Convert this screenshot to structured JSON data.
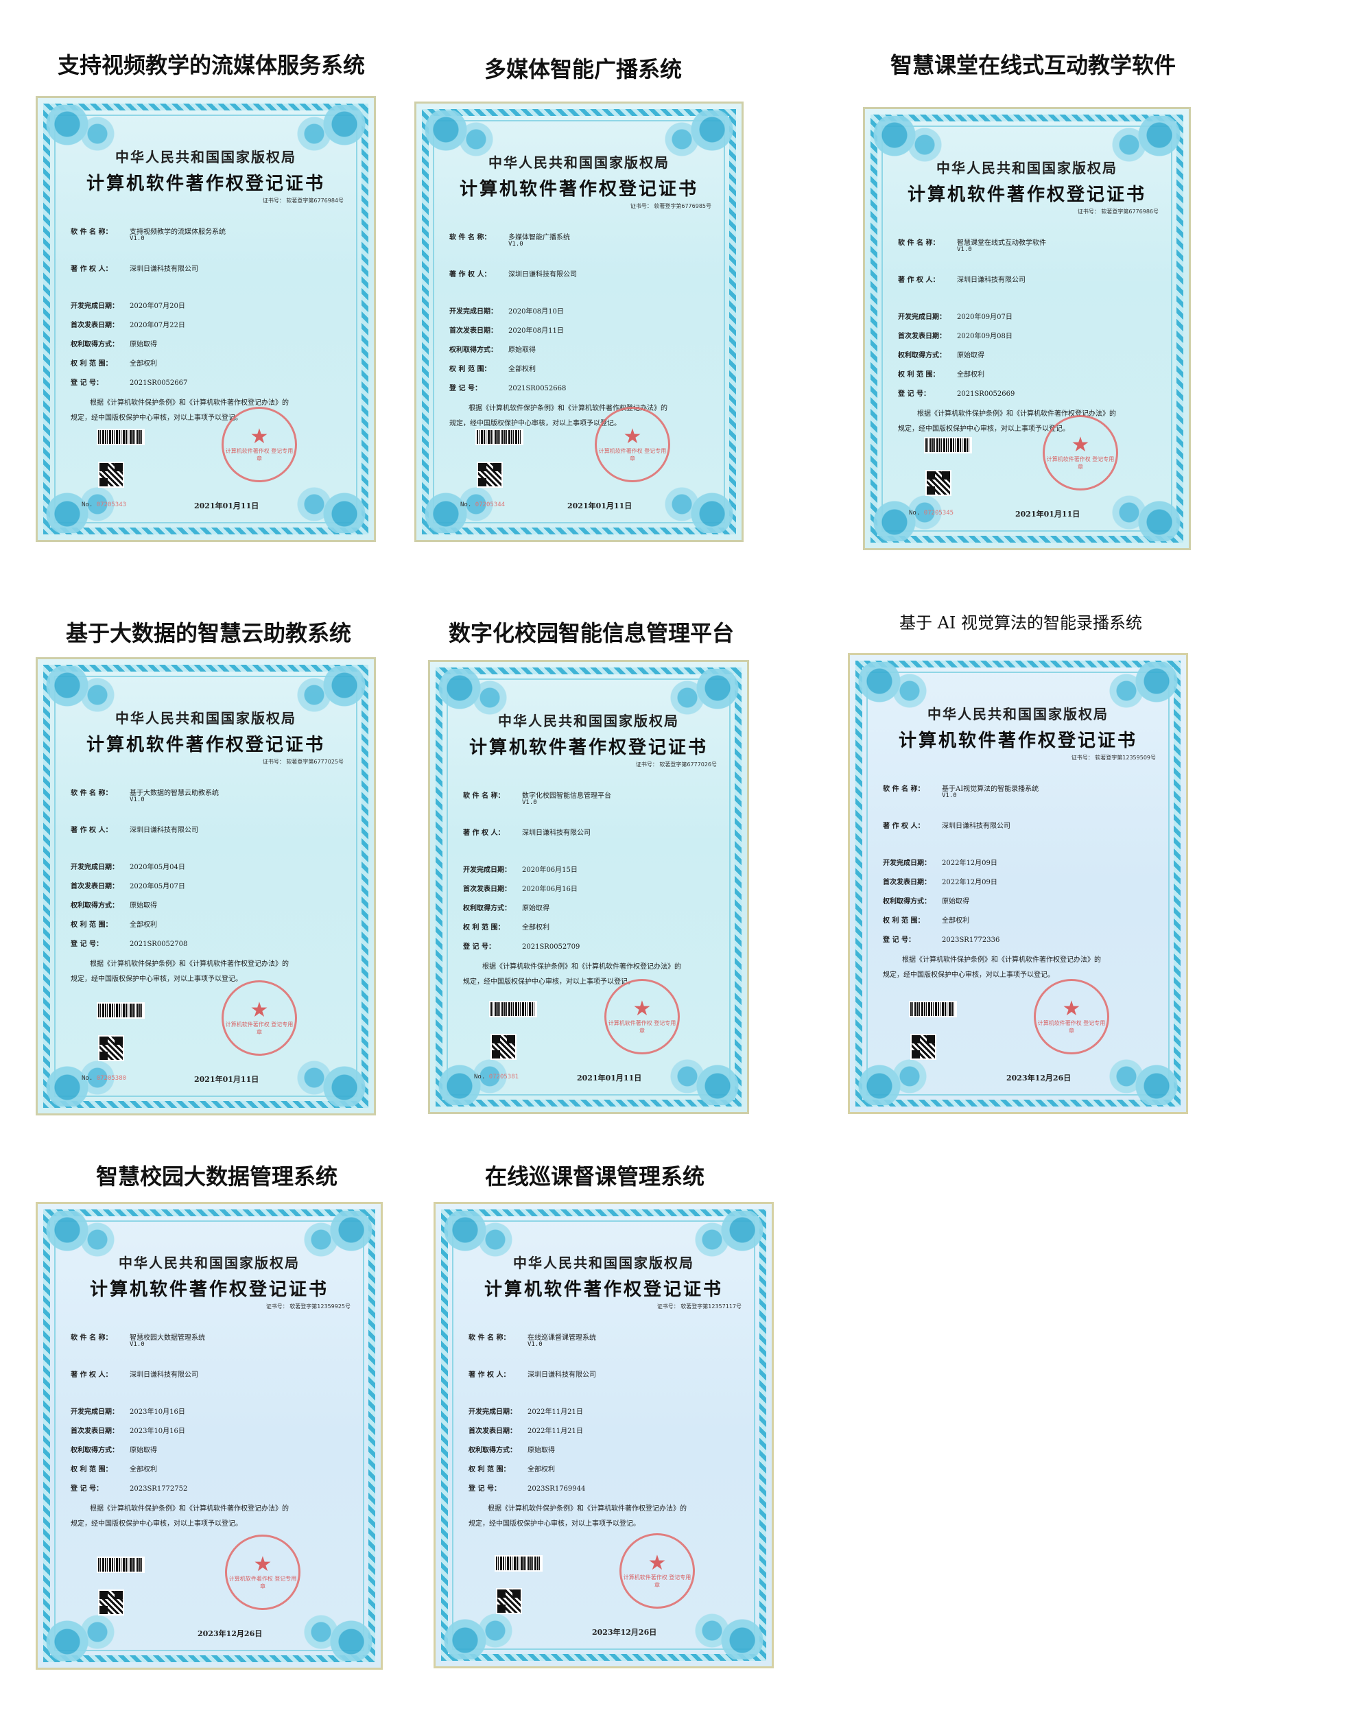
{
  "certificates": [
    {
      "caption": "支持视频教学的流媒体服务系统",
      "authority": "中华人民共和国国家版权局",
      "title": "计算机软件著作权登记证书",
      "cert_no": "证书号： 软著登字第6776984号",
      "software_label": "软 件 名 称：",
      "software_name": "支持视频教学的流媒体服务系统",
      "version": "V1.0",
      "owner_label": "著 作 权 人：",
      "owner": "深圳日谦科技有限公司",
      "dev_date_label": "开发完成日期：",
      "dev_date": "2020年07月20日",
      "pub_date_label": "首次发表日期：",
      "pub_date": "2020年07月22日",
      "acq_label": "权利取得方式：",
      "acq": "原始取得",
      "scope_label": "权 利 范 围：",
      "scope": "全部权利",
      "reg_label": "登    记    号：",
      "reg_no": "2021SR0052667",
      "para_line1": "根据《计算机软件保护条例》和《计算机软件著作权登记办法》的",
      "para_line2": "规定，经中国版权保护中心审核，对以上事项予以登记。",
      "seal_text": "计算机软件著作权 登记专用章",
      "no_label": "No.",
      "no_value": "07205343",
      "issue_date": "2021年01月11日"
    },
    {
      "caption": "多媒体智能广播系统",
      "authority": "中华人民共和国国家版权局",
      "title": "计算机软件著作权登记证书",
      "cert_no": "证书号： 软著登字第6776985号",
      "software_label": "软 件 名 称：",
      "software_name": "多媒体智能广播系统",
      "version": "V1.0",
      "owner_label": "著 作 权 人：",
      "owner": "深圳日谦科技有限公司",
      "dev_date_label": "开发完成日期：",
      "dev_date": "2020年08月10日",
      "pub_date_label": "首次发表日期：",
      "pub_date": "2020年08月11日",
      "acq_label": "权利取得方式：",
      "acq": "原始取得",
      "scope_label": "权 利 范 围：",
      "scope": "全部权利",
      "reg_label": "登    记    号：",
      "reg_no": "2021SR0052668",
      "para_line1": "根据《计算机软件保护条例》和《计算机软件著作权登记办法》的",
      "para_line2": "规定，经中国版权保护中心审核，对以上事项予以登记。",
      "seal_text": "计算机软件著作权 登记专用章",
      "no_label": "No.",
      "no_value": "07205344",
      "issue_date": "2021年01月11日"
    },
    {
      "caption": "智慧课堂在线式互动教学软件",
      "authority": "中华人民共和国国家版权局",
      "title": "计算机软件著作权登记证书",
      "cert_no": "证书号： 软著登字第6776986号",
      "software_label": "软 件 名 称：",
      "software_name": "智慧课堂在线式互动教学软件",
      "version": "V1.0",
      "owner_label": "著 作 权 人：",
      "owner": "深圳日谦科技有限公司",
      "dev_date_label": "开发完成日期：",
      "dev_date": "2020年09月07日",
      "pub_date_label": "首次发表日期：",
      "pub_date": "2020年09月08日",
      "acq_label": "权利取得方式：",
      "acq": "原始取得",
      "scope_label": "权 利 范 围：",
      "scope": "全部权利",
      "reg_label": "登    记    号：",
      "reg_no": "2021SR0052669",
      "para_line1": "根据《计算机软件保护条例》和《计算机软件著作权登记办法》的",
      "para_line2": "规定，经中国版权保护中心审核，对以上事项予以登记。",
      "seal_text": "计算机软件著作权 登记专用章",
      "no_label": "No.",
      "no_value": "07205345",
      "issue_date": "2021年01月11日"
    },
    {
      "caption": "基于大数据的智慧云助教系统",
      "authority": "中华人民共和国国家版权局",
      "title": "计算机软件著作权登记证书",
      "cert_no": "证书号： 软著登字第6777025号",
      "software_label": "软 件 名 称：",
      "software_name": "基于大数据的智慧云助教系统",
      "version": "V1.0",
      "owner_label": "著 作 权 人：",
      "owner": "深圳日谦科技有限公司",
      "dev_date_label": "开发完成日期：",
      "dev_date": "2020年05月04日",
      "pub_date_label": "首次发表日期：",
      "pub_date": "2020年05月07日",
      "acq_label": "权利取得方式：",
      "acq": "原始取得",
      "scope_label": "权 利 范 围：",
      "scope": "全部权利",
      "reg_label": "登    记    号：",
      "reg_no": "2021SR0052708",
      "para_line1": "根据《计算机软件保护条例》和《计算机软件著作权登记办法》的",
      "para_line2": "规定，经中国版权保护中心审核，对以上事项予以登记。",
      "seal_text": "计算机软件著作权 登记专用章",
      "no_label": "No.",
      "no_value": "07205380",
      "issue_date": "2021年01月11日"
    },
    {
      "caption": "数字化校园智能信息管理平台",
      "authority": "中华人民共和国国家版权局",
      "title": "计算机软件著作权登记证书",
      "cert_no": "证书号： 软著登字第6777026号",
      "software_label": "软 件 名 称：",
      "software_name": "数字化校园智能信息管理平台",
      "version": "V1.0",
      "owner_label": "著 作 权 人：",
      "owner": "深圳日谦科技有限公司",
      "dev_date_label": "开发完成日期：",
      "dev_date": "2020年06月15日",
      "pub_date_label": "首次发表日期：",
      "pub_date": "2020年06月16日",
      "acq_label": "权利取得方式：",
      "acq": "原始取得",
      "scope_label": "权 利 范 围：",
      "scope": "全部权利",
      "reg_label": "登    记    号：",
      "reg_no": "2021SR0052709",
      "para_line1": "根据《计算机软件保护条例》和《计算机软件著作权登记办法》的",
      "para_line2": "规定，经中国版权保护中心审核，对以上事项予以登记。",
      "seal_text": "计算机软件著作权 登记专用章",
      "no_label": "No.",
      "no_value": "07205381",
      "issue_date": "2021年01月11日"
    },
    {
      "caption": "基于 AI 视觉算法的智能录播系统",
      "authority": "中华人民共和国国家版权局",
      "title": "计算机软件著作权登记证书",
      "cert_no": "证书号： 软著登字第12359509号",
      "software_label": "软 件 名 称：",
      "software_name": "基于AI视觉算法的智能录播系统",
      "version": "V1.0",
      "owner_label": "著 作 权 人：",
      "owner": "深圳日谦科技有限公司",
      "dev_date_label": "开发完成日期：",
      "dev_date": "2022年12月09日",
      "pub_date_label": "首次发表日期：",
      "pub_date": "2022年12月09日",
      "acq_label": "权利取得方式：",
      "acq": "原始取得",
      "scope_label": "权 利 范 围：",
      "scope": "全部权利",
      "reg_label": "登    记    号：",
      "reg_no": "2023SR1772336",
      "para_line1": "根据《计算机软件保护条例》和《计算机软件著作权登记办法》的",
      "para_line2": "规定，经中国版权保护中心审核，对以上事项予以登记。",
      "seal_text": "计算机软件著作权 登记专用章",
      "no_label": "",
      "no_value": "",
      "issue_date": "2023年12月26日"
    },
    {
      "caption": "智慧校园大数据管理系统",
      "authority": "中华人民共和国国家版权局",
      "title": "计算机软件著作权登记证书",
      "cert_no": "证书号： 软著登字第12359925号",
      "software_label": "软 件 名 称：",
      "software_name": "智慧校园大数据管理系统",
      "version": "V1.0",
      "owner_label": "著 作 权 人：",
      "owner": "深圳日谦科技有限公司",
      "dev_date_label": "开发完成日期：",
      "dev_date": "2023年10月16日",
      "pub_date_label": "首次发表日期：",
      "pub_date": "2023年10月16日",
      "acq_label": "权利取得方式：",
      "acq": "原始取得",
      "scope_label": "权 利 范 围：",
      "scope": "全部权利",
      "reg_label": "登    记    号：",
      "reg_no": "2023SR1772752",
      "para_line1": "根据《计算机软件保护条例》和《计算机软件著作权登记办法》的",
      "para_line2": "规定，经中国版权保护中心审核，对以上事项予以登记。",
      "seal_text": "计算机软件著作权 登记专用章",
      "no_label": "",
      "no_value": "",
      "issue_date": "2023年12月26日"
    },
    {
      "caption": "在线巡课督课管理系统",
      "authority": "中华人民共和国国家版权局",
      "title": "计算机软件著作权登记证书",
      "cert_no": "证书号： 软著登字第12357117号",
      "software_label": "软 件 名 称：",
      "software_name": "在线巡课督课管理系统",
      "version": "V1.0",
      "owner_label": "著 作 权 人：",
      "owner": "深圳日谦科技有限公司",
      "dev_date_label": "开发完成日期：",
      "dev_date": "2022年11月21日",
      "pub_date_label": "首次发表日期：",
      "pub_date": "2022年11月21日",
      "acq_label": "权利取得方式：",
      "acq": "原始取得",
      "scope_label": "权 利 范 围：",
      "scope": "全部权利",
      "reg_label": "登    记    号：",
      "reg_no": "2023SR1769944",
      "para_line1": "根据《计算机软件保护条例》和《计算机软件著作权登记办法》的",
      "para_line2": "规定，经中国版权保护中心审核，对以上事项予以登记。",
      "seal_text": "计算机软件著作权 登记专用章",
      "no_label": "",
      "no_value": "",
      "issue_date": "2023年12月26日"
    }
  ]
}
